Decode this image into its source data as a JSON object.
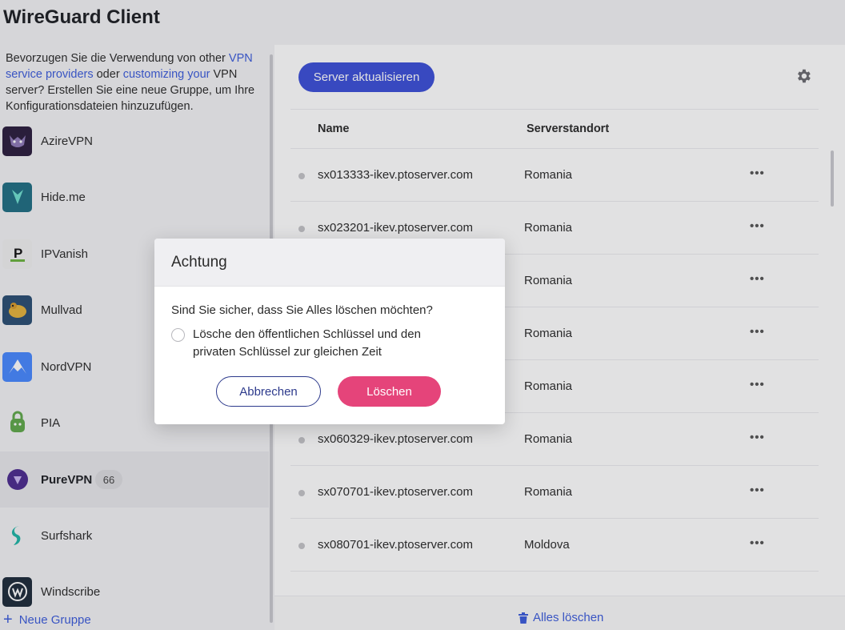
{
  "app": {
    "title": "WireGuard Client"
  },
  "sidebar": {
    "intro": {
      "text_1": "Bevorzugen Sie die Verwendung von other",
      "link_1": "VPN service providers",
      "text_2": " oder ",
      "link_2": "customizing your",
      "text_3": "VPN server? Erstellen Sie eine neue Gruppe, um Ihre Konfigurationsdateien hinzuzufügen."
    },
    "providers": [
      {
        "name": "AzireVPN",
        "icon": "azirevpn-logo",
        "color": "#2b1d3d"
      },
      {
        "name": "Hide.me",
        "icon": "hideme-logo",
        "color": "#1f6e83"
      },
      {
        "name": "IPVanish",
        "icon": "ipvanish-logo",
        "color": "#f0f0f0"
      },
      {
        "name": "Mullvad",
        "icon": "mullvad-logo",
        "color": "#294d73"
      },
      {
        "name": "NordVPN",
        "icon": "nordvpn-logo",
        "color": "#4687ff"
      },
      {
        "name": "PIA",
        "icon": "pia-logo",
        "color": "#5fa84a"
      },
      {
        "name": "PureVPN",
        "icon": "purevpn-logo",
        "color": "#6b3fbf",
        "badge": "66",
        "active": true
      },
      {
        "name": "Surfshark",
        "icon": "surfshark-logo",
        "color": "#1eb5a6"
      },
      {
        "name": "Windscribe",
        "icon": "windscribe-logo",
        "color": "#1d2a3a"
      }
    ],
    "new_group": "Neue Gruppe"
  },
  "main": {
    "refresh_label": "Server aktualisieren",
    "columns": {
      "name": "Name",
      "location": "Serverstandort"
    },
    "rows": [
      {
        "name": "sx013333-ikev.ptoserver.com",
        "location": "Romania"
      },
      {
        "name": "sx023201-ikev.ptoserver.com",
        "location": "Romania"
      },
      {
        "name": "",
        "location": "Romania"
      },
      {
        "name": "",
        "location": "Romania"
      },
      {
        "name": "",
        "location": "Romania"
      },
      {
        "name": "sx060329-ikev.ptoserver.com",
        "location": "Romania"
      },
      {
        "name": "sx070701-ikev.ptoserver.com",
        "location": "Romania"
      },
      {
        "name": "sx080701-ikev.ptoserver.com",
        "location": "Moldova"
      }
    ],
    "more_label": "•••",
    "delete_all": "Alles löschen"
  },
  "modal": {
    "title": "Achtung",
    "question": "Sind Sie sicher, dass Sie Alles löschen möchten?",
    "option_label": "Lösche den öffentlichen Schlüssel und den privaten Schlüssel zur gleichen Zeit",
    "cancel_label": "Abbrechen",
    "delete_label": "Löschen"
  },
  "colors": {
    "accent": "#3b4fd8",
    "danger": "#e5447a",
    "link": "#3b5bdb"
  }
}
